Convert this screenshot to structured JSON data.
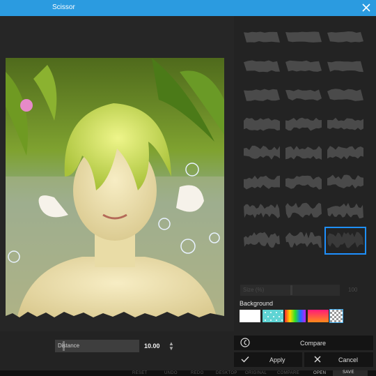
{
  "window": {
    "title": "Scissor"
  },
  "icons": {
    "close": "close-icon",
    "compare": "compare-icon",
    "apply": "check-icon",
    "cancel": "x-icon",
    "spin": "spinner-arrows-icon"
  },
  "presets": {
    "count": 24,
    "selected_index": 23
  },
  "size_slider": {
    "label": "Size (%)",
    "value": "100",
    "disabled": true
  },
  "background": {
    "label": "Background",
    "options": [
      "white",
      "teal-pattern",
      "rainbow",
      "pink-orange-gradient",
      "transparent-checker"
    ]
  },
  "distance": {
    "label": "Distance",
    "value": "10.00"
  },
  "buttons": {
    "compare": "Compare",
    "apply": "Apply",
    "cancel": "Cancel"
  },
  "bottom_bar": {
    "items": [
      "RESET",
      "UNDO",
      "REDO",
      "DESKTOP",
      "ORIGINAL",
      "COMPARE"
    ],
    "open": "OPEN",
    "save": "SAVE"
  },
  "colors": {
    "accent": "#2b9be0",
    "selection": "#1e90ff",
    "dialog_bg": "#232323"
  }
}
